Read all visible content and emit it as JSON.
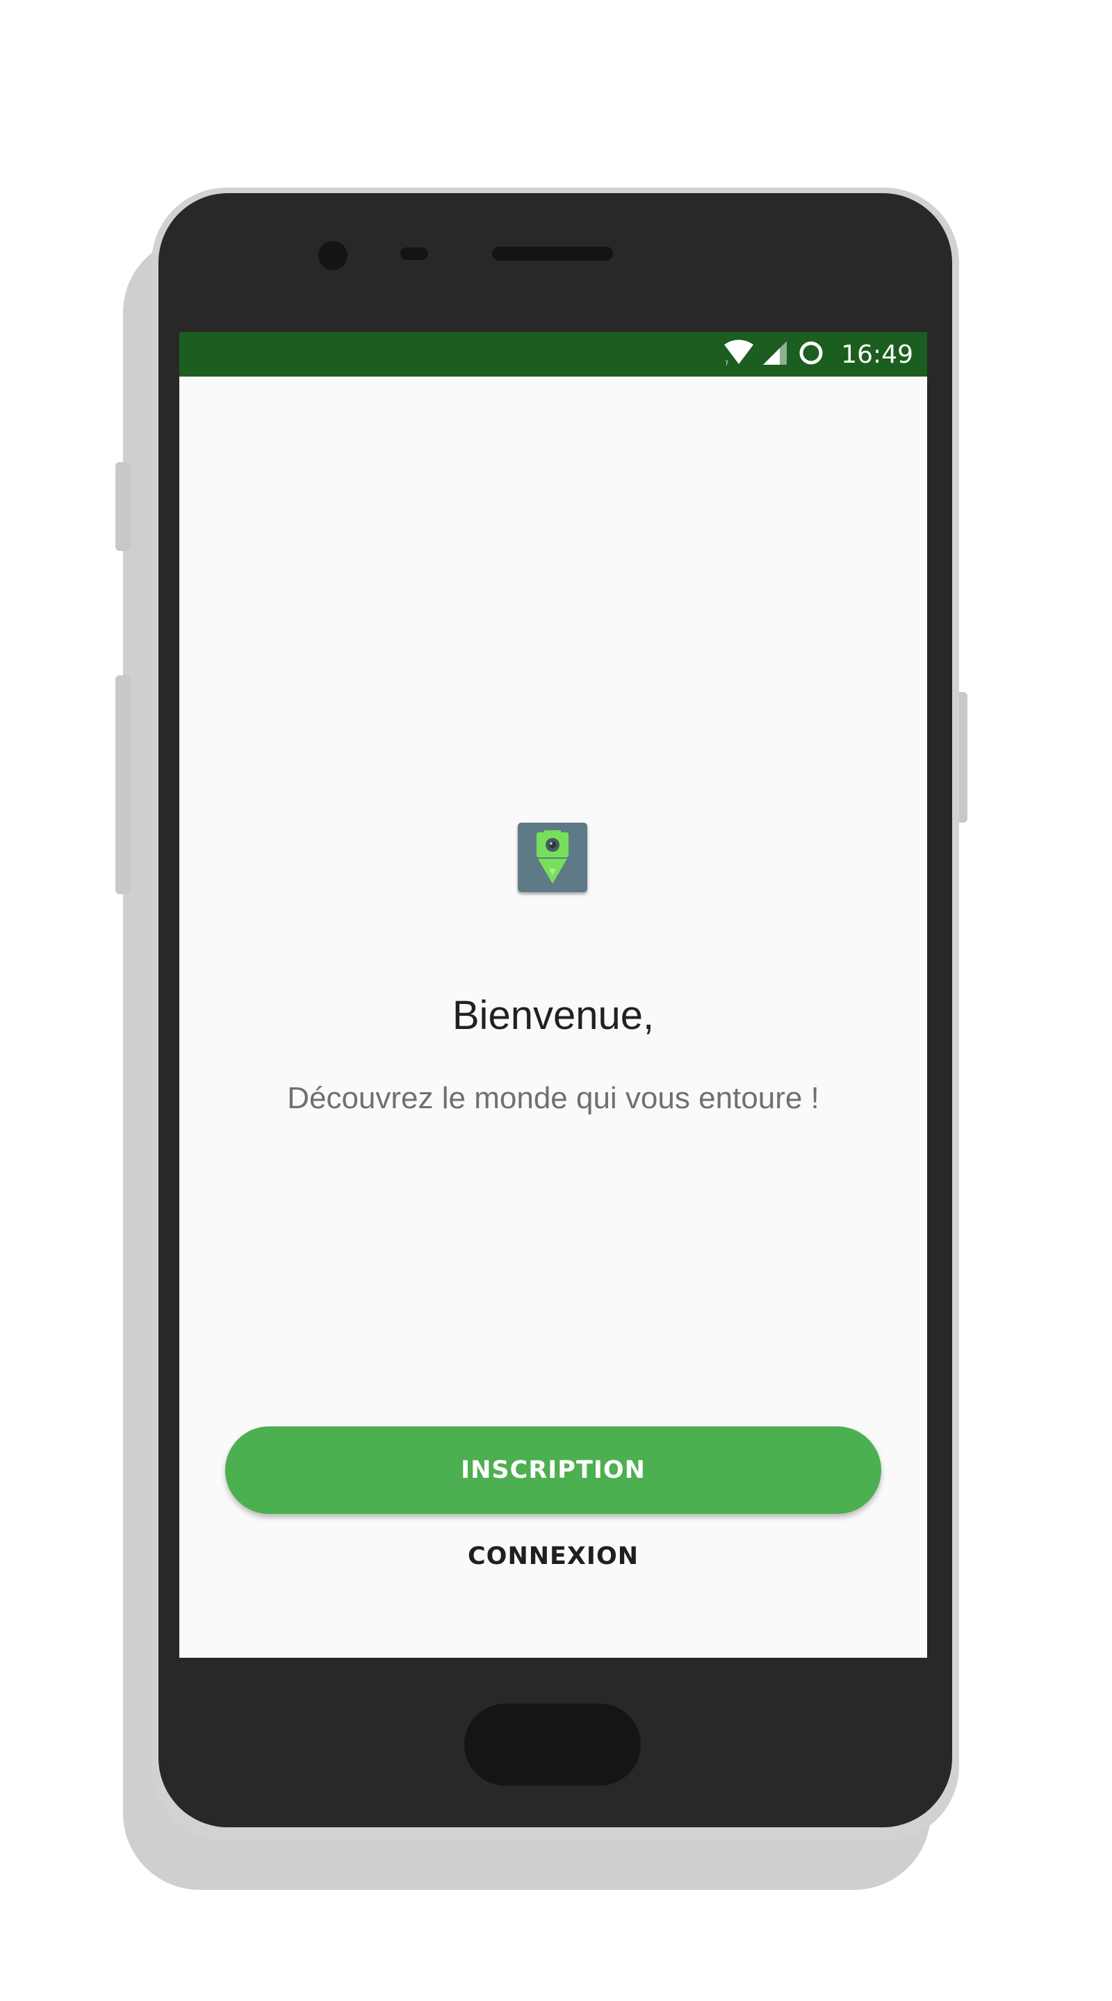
{
  "status_bar": {
    "time": "16:49",
    "icons": [
      "wifi-icon",
      "cell-signal-icon",
      "sync-circle-icon"
    ],
    "color": "#1b5e20"
  },
  "app": {
    "logo_icon": "map-pin-camera-icon",
    "welcome_title": "Bienvenue,",
    "welcome_subtitle": "Découvrez le monde qui vous entoure !",
    "signup_label": "INSCRIPTION",
    "login_label": "CONNEXION"
  },
  "colors": {
    "accent": "#4caf50",
    "primary_dark": "#1b5e20",
    "logo_background": "#5f7a87",
    "logo_green": "#76e05a"
  }
}
